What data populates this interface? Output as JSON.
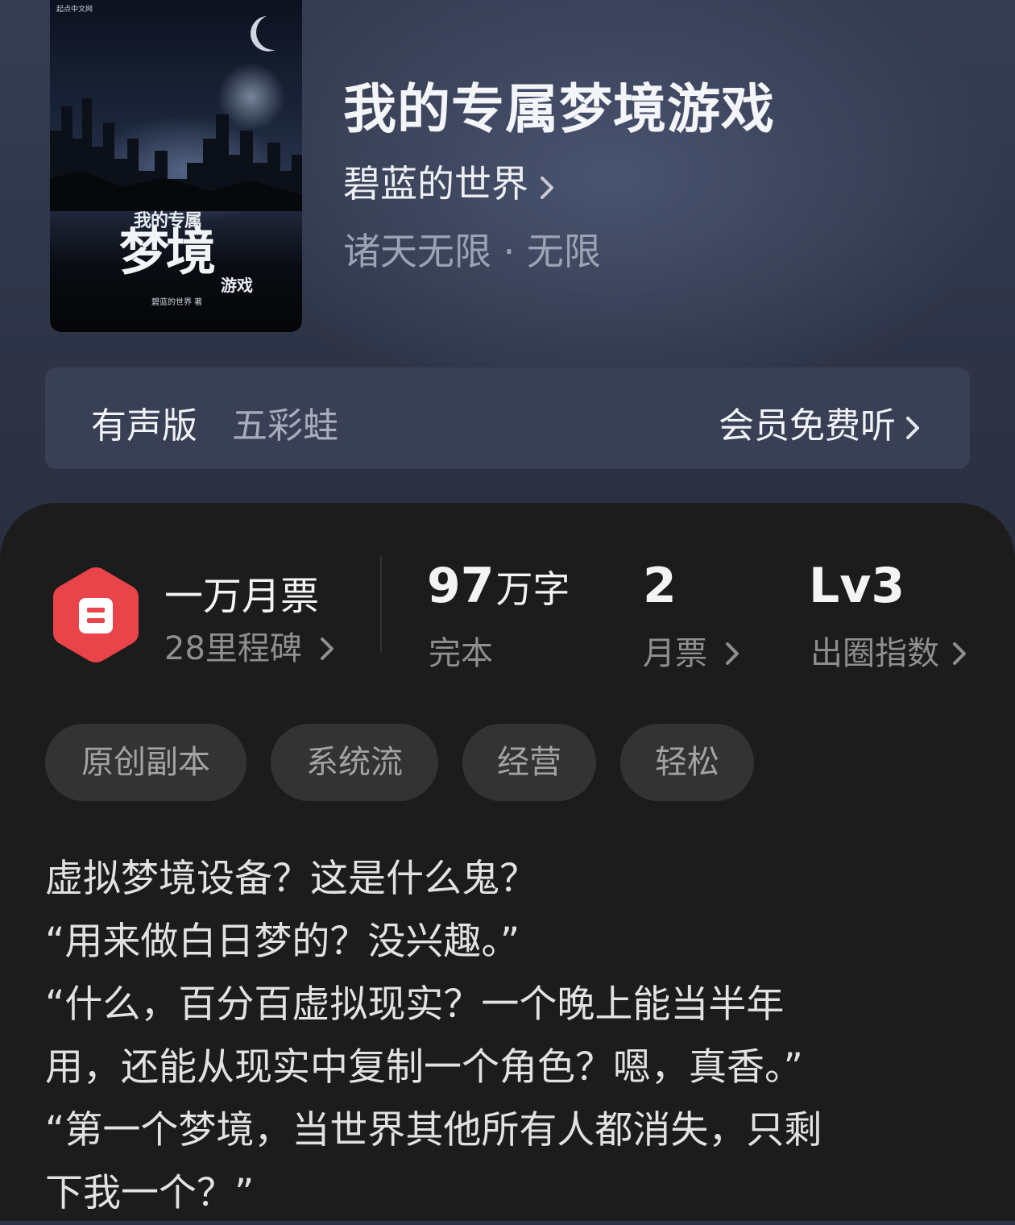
{
  "book": {
    "title": "我的专属梦境游戏",
    "author": "碧蓝的世界",
    "genre": "诸天无限 · 无限",
    "cover": {
      "publisher": "起点中文网",
      "line1": "我的专属",
      "line2": "梦境",
      "line3": "游戏",
      "author_line": "碧蓝的世界 著"
    }
  },
  "audio": {
    "label": "有声版",
    "narrator": "五彩蛙",
    "cta": "会员免费听"
  },
  "stats": {
    "monthly_badge": "一万月票",
    "milestones": "28里程碑",
    "word_count_value": "97",
    "word_count_unit": "万字",
    "status": "完本",
    "monthly_tickets_value": "2",
    "monthly_tickets_label": "月票",
    "level_value": "Lv3",
    "level_label": "出圈指数"
  },
  "tags": [
    "原创副本",
    "系统流",
    "经营",
    "轻松"
  ],
  "synopsis": [
    "虚拟梦境设备？这是什么鬼？",
    "“用来做白日梦的？没兴趣。”",
    "“什么，百分百虚拟现实？一个晚上能当半年",
    "用，还能从现实中复制一个角色？嗯，真香。”",
    "“第一个梦境，当世界其他所有人都消失，只剩",
    "下我一个？”"
  ],
  "colors": {
    "hero_bg": "#2f3548",
    "panel_bg": "#1c1c1c",
    "badge_red": "#e8444a",
    "tag_bg": "#333333"
  },
  "icons": [
    "chevron-right-icon",
    "monthly-ticket-badge-icon"
  ]
}
